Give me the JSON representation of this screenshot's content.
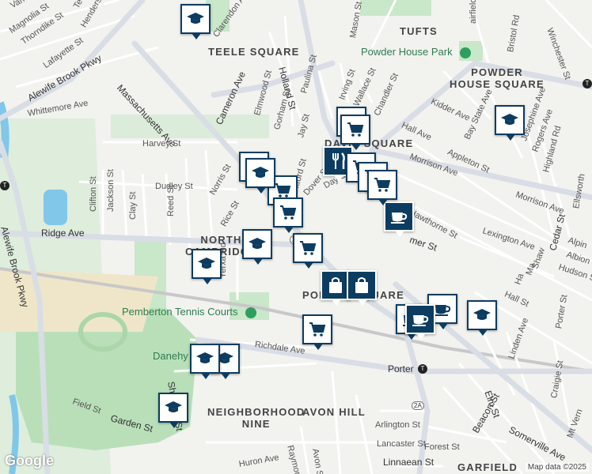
{
  "map": {
    "colors": {
      "background": "#f2f2ef",
      "road": "#ffffff",
      "arterial": "#d9dde5",
      "park": "#c9e7c9",
      "water": "#80c7ea",
      "rail": "#c8c8c8",
      "sand": "#efe6c9",
      "marker_dark": "#0d3c61",
      "marker_light": "#ffffff"
    },
    "areas": {
      "tufts": "TUFTS",
      "teele_square": "TEELE SQUARE",
      "powder_house_square_1": "POWDER",
      "powder_house_square_2": "HOUSE SQUARE",
      "davis_square": "DAVIS SQUARE",
      "north_cambridge_1": "NORTH",
      "north_cambridge_2": "CAMBRIDGE",
      "porter_square": "PORTER SQUARE",
      "neighborhood_nine_1": "NEIGHBORHOOD",
      "neighborhood_nine_2": "NINE",
      "avon_hill": "AVON HILL",
      "garfield": "GARFIELD"
    },
    "parks": {
      "powder_house_park": "Powder House Park",
      "pemberton_tennis_courts": "Pemberton Tennis Courts",
      "danehy_park": "Danehy Park"
    },
    "streets": {
      "varnum": "Varnum St",
      "magnolia": "Magnolia St",
      "thorndike": "Thorndike St",
      "lafayette": "Lafayette St",
      "henderson": "Henderson",
      "te": "Te",
      "alewife_brook_pkwy_top": "Alewife Brook Pkwy",
      "alewife_brook_pkwy_side": "Alewife Brook Pkwy",
      "massachusetts_ave": "Massachusetts Ave",
      "whittemore": "Whittemore Ave",
      "clarendon": "Clarendon Ave",
      "cameron": "Cameron Ave",
      "holland": "Holland St",
      "mason": "Mason St",
      "paulina": "Paulina St",
      "elmwood": "Elmwood St",
      "gorham": "Gorham St",
      "jay": "Jay St",
      "irving": "Irving St",
      "wallace": "Wallace St",
      "chandler": "Chandler St",
      "fairfield": "airfield Rd",
      "bristol": "Bristol Rd",
      "winchester": "Winchester St",
      "kidder": "Kidder Ave",
      "bay_state": "Bay State Ave",
      "hall_top": "Hall Ave",
      "appleton": "Appleton St",
      "josephine": "Josephine Ave",
      "rogers": "Rogers Ave",
      "highland": "Highland Rd",
      "morrison_1": "Morrison Ave",
      "morrison_2": "Morrison Ave",
      "harvey": "Harvey St",
      "dudley": "Dudley St",
      "norris": "Norris St",
      "dover": "Dover St",
      "day": "Day St",
      "rice": "Rice St",
      "clifton": "Clifton St",
      "jackson": "Jackson St",
      "clay": "Clay St",
      "reed": "Reed St",
      "ridge": "Ridge Ave",
      "hawthorne": "Hawthorne St",
      "lexington": "Lexington Ave",
      "cedar": "Cedar St",
      "alpine": "Alpin",
      "albion": "Albion",
      "hudson": "Hudson S",
      "summer": "mer St",
      "yerxa": "Yerxa Rd",
      "hall_2": "Hall St",
      "richdale": "Richdale Ave",
      "porter_station": "Porter",
      "linden": "Linden Ave",
      "elm": "Elm St",
      "porter_st": "Porter St",
      "craigie": "Craigie St",
      "field": "Field St",
      "garden": "Garden St",
      "sherman": "Sherman St",
      "arlington": "Arlington St",
      "lancaster": "Lancaster St",
      "forest": "Forest St",
      "somerville_ave": "Somerville Ave",
      "beacon": "Beacon St",
      "mt_vernon": "Mt Vern",
      "huron": "Huron Ave",
      "raymond": "Raymond St",
      "avon": "Avon St",
      "linnaean": "Linnaean St",
      "oxford": "Oxford St",
      "shaw": "Shaw",
      "ha": "Ha",
      "ma": "Ma",
      "ellsworth": "Ellsworth"
    },
    "route_shields": {
      "r1": "2",
      "r2": "2A"
    },
    "station_icon": "T",
    "markers": [
      {
        "kind": "school",
        "style": "light",
        "icon": "graduation-cap-icon"
      },
      {
        "kind": "school",
        "style": "light",
        "icon": "graduation-cap-icon"
      },
      {
        "kind": "grocery",
        "style": "light",
        "icon": "shopping-cart-icon"
      },
      {
        "kind": "grocery",
        "style": "light",
        "icon": "shopping-cart-icon"
      },
      {
        "kind": "restaurant",
        "style": "dark",
        "icon": "fork-knife-icon"
      },
      {
        "kind": "grocery",
        "style": "light",
        "icon": "shopping-cart-icon"
      },
      {
        "kind": "grocery",
        "style": "light",
        "icon": "shopping-cart-icon"
      },
      {
        "kind": "school",
        "style": "light",
        "icon": "graduation-cap-icon"
      },
      {
        "kind": "grocery",
        "style": "light",
        "icon": "shopping-cart-icon"
      },
      {
        "kind": "cafe",
        "style": "dark",
        "icon": "coffee-cup-icon"
      },
      {
        "kind": "grocery",
        "style": "light",
        "icon": "shopping-cart-icon"
      },
      {
        "kind": "cafe",
        "style": "light",
        "icon": "coffee-cup-icon"
      },
      {
        "kind": "school",
        "style": "light",
        "icon": "graduation-cap-icon"
      },
      {
        "kind": "school",
        "style": "light",
        "icon": "graduation-cap-icon"
      },
      {
        "kind": "grocery",
        "style": "light",
        "icon": "shopping-cart-icon"
      },
      {
        "kind": "shopping",
        "style": "dark",
        "icon": "shopping-bag-icon"
      },
      {
        "kind": "shopping",
        "style": "dark",
        "icon": "shopping-bag-icon"
      },
      {
        "kind": "cafe",
        "style": "light",
        "icon": "coffee-cup-icon"
      },
      {
        "kind": "cafe",
        "style": "dark",
        "icon": "coffee-cup-icon"
      },
      {
        "kind": "school",
        "style": "light",
        "icon": "graduation-cap-icon"
      },
      {
        "kind": "grocery",
        "style": "light",
        "icon": "shopping-cart-icon"
      },
      {
        "kind": "school",
        "style": "light",
        "icon": "graduation-cap-icon"
      },
      {
        "kind": "school",
        "style": "light",
        "icon": "graduation-cap-icon"
      },
      {
        "kind": "school",
        "style": "light",
        "icon": "graduation-cap-icon"
      },
      {
        "kind": "school",
        "style": "light",
        "icon": "graduation-cap-icon"
      },
      {
        "kind": "grocery",
        "style": "light",
        "icon": "shopping-cart-icon"
      }
    ],
    "attribution": {
      "logo": "Google",
      "credit": "Map data ©2025"
    }
  }
}
